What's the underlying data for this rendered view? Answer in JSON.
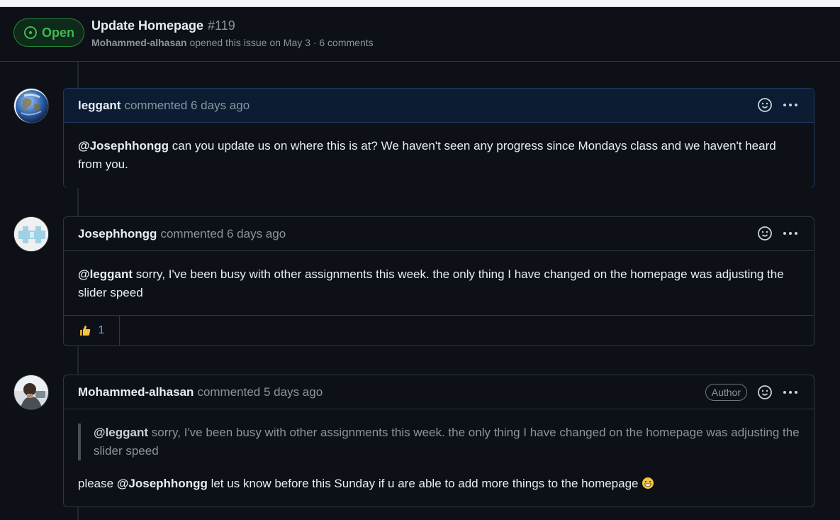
{
  "issue": {
    "state": "Open",
    "title": "Update Homepage",
    "number": "#119",
    "author": "Mohammed-alhasan",
    "meta_rest": "opened this issue on May 3 · 6 comments"
  },
  "comments": [
    {
      "user": "leggant",
      "action": "commented 6 days ago",
      "mention": "@Josephhongg",
      "body": " can you update us on where this is at? We haven't seen any progress since Mondays class and we haven't heard from you."
    },
    {
      "user": "Josephhongg",
      "action": "commented 6 days ago",
      "mention": "@leggant",
      "body": " sorry, I've been busy with other assignments this week. the only thing I have changed on the homepage was adjusting the slider speed",
      "reaction_count": "1"
    },
    {
      "user": "Mohammed-alhasan",
      "action": "commented 5 days ago",
      "author_badge": "Author",
      "quote_mention": "@leggant",
      "quote_body": " sorry, I've been busy with other assignments this week. the only thing I have changed on the homepage was adjusting the slider speed",
      "body_pre": "please ",
      "mention": "@Josephhongg",
      "body_post": " let us know before this Sunday if u are able to add more things to the homepage "
    }
  ],
  "icons": {
    "state": "issue-open-icon",
    "reaction": "thumbs-up-icon",
    "emoji": "grinning-emoji-icon"
  },
  "colors": {
    "open": "#3fb950",
    "link": "#58a6ff",
    "background": "#0d1117"
  }
}
